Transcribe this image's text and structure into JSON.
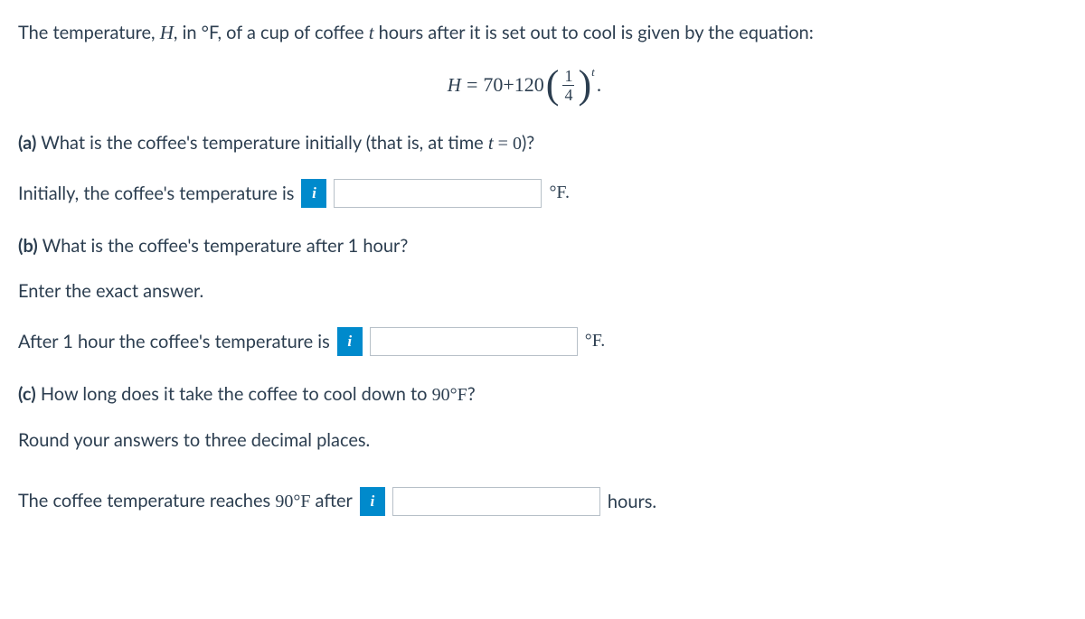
{
  "intro": {
    "prefix": "The temperature, ",
    "var_H": "H",
    "sep1": ", ",
    "units_pre": "in °",
    "units_F": "F",
    "mid1": ", of a cup of coffee ",
    "var_t": "t",
    "suffix": " hours after it is set out to cool is given by the equation:"
  },
  "equation": {
    "lhs_var": "H",
    "eq": " = ",
    "c1": "70",
    "plus": " + ",
    "c2": "120",
    "frac_num": "1",
    "frac_den": "4",
    "exp": "t",
    "period": "."
  },
  "part_a": {
    "label": "(a)",
    "text1": " What is the coffee's temperature initially (that is, at time ",
    "var_t": "t",
    "text2": " = ",
    "zero": "0",
    "text3": ")?"
  },
  "ans_a": {
    "text": "Initially, the coffee's temperature is",
    "unit": "°F."
  },
  "part_b": {
    "label": "(b)",
    "text": " What is the coffee's temperature after 1 hour?"
  },
  "hint_b": "Enter the exact answer.",
  "ans_b": {
    "text": "After 1 hour the coffee's temperature is",
    "unit": "°F."
  },
  "part_c": {
    "label": "(c)",
    "text1": " How long does it take the coffee to cool down to ",
    "val": "90°",
    "f": "F",
    "text2": "?"
  },
  "hint_c": "Round your answers to three decimal places.",
  "ans_c": {
    "text1": "The coffee temperature reaches ",
    "val": "90°",
    "f": "F",
    "text2": " after",
    "unit": "hours."
  },
  "info_glyph": "i"
}
